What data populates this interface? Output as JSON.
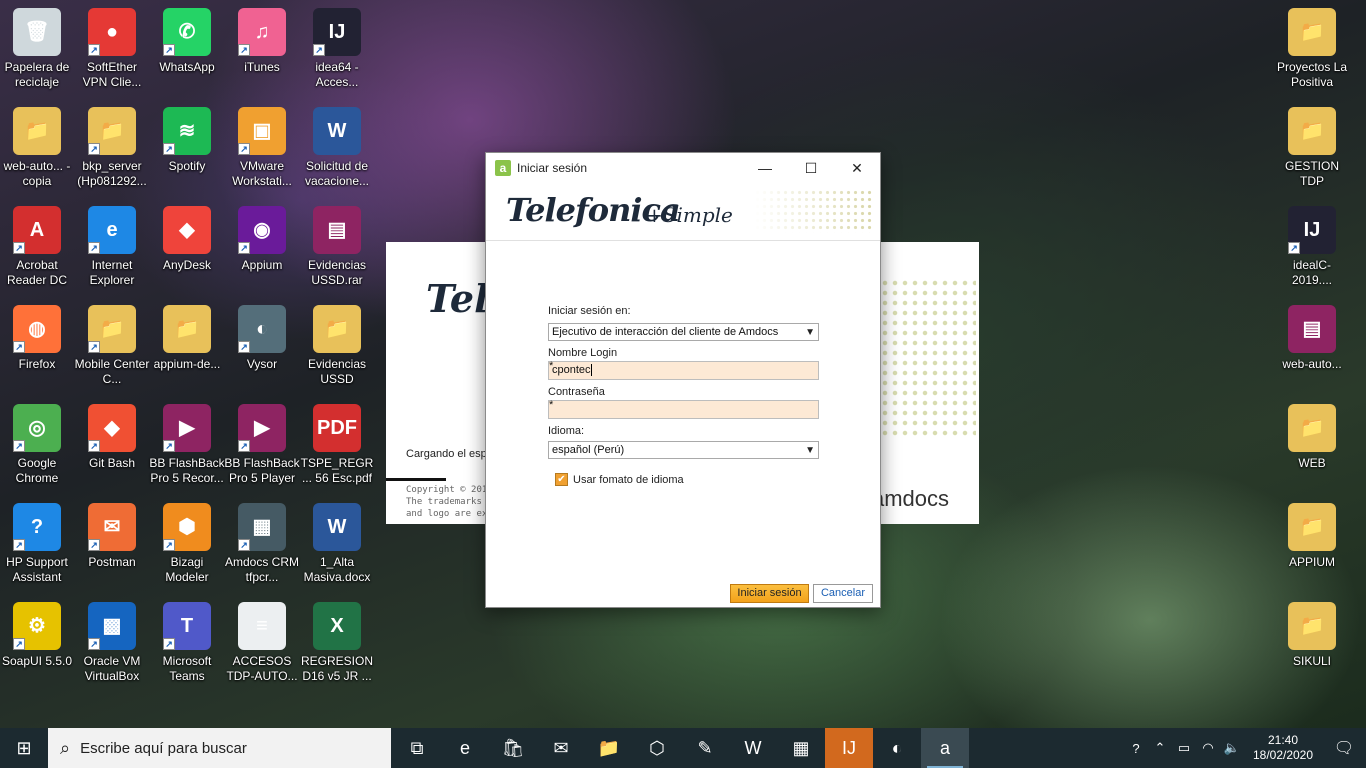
{
  "desktop_left": [
    {
      "name": "recycle-bin",
      "label": "Papelera de reciclaje",
      "color": "#cfd8dc",
      "glyph": "🗑",
      "shortcut": false
    },
    {
      "name": "softether",
      "label": "SoftEther VPN Clie...",
      "color": "#e53935",
      "glyph": "●",
      "shortcut": true
    },
    {
      "name": "whatsapp",
      "label": "WhatsApp",
      "color": "#25d366",
      "glyph": "✆",
      "shortcut": true
    },
    {
      "name": "itunes",
      "label": "iTunes",
      "color": "#f06292",
      "glyph": "♫",
      "shortcut": true
    },
    {
      "name": "idea64",
      "label": "idea64 - Acces...",
      "color": "#222233",
      "glyph": "IJ",
      "shortcut": true
    },
    {
      "name": "web-auto-copia",
      "label": "web-auto... - copia",
      "color": "#e8c15a",
      "glyph": "📁",
      "shortcut": false
    },
    {
      "name": "bkp-server",
      "label": "bkp_server (Hp081292...",
      "color": "#e8c15a",
      "glyph": "📁",
      "shortcut": true
    },
    {
      "name": "spotify",
      "label": "Spotify",
      "color": "#1db954",
      "glyph": "≋",
      "shortcut": true
    },
    {
      "name": "vmware",
      "label": "VMware Workstati...",
      "color": "#f0a030",
      "glyph": "▣",
      "shortcut": true
    },
    {
      "name": "solicitud-vacaciones",
      "label": "Solicitud de vacacione...",
      "color": "#2b579a",
      "glyph": "W",
      "shortcut": false
    },
    {
      "name": "acrobat",
      "label": "Acrobat Reader DC",
      "color": "#d32f2f",
      "glyph": "A",
      "shortcut": true
    },
    {
      "name": "internet-explorer",
      "label": "Internet Explorer",
      "color": "#1e88e5",
      "glyph": "e",
      "shortcut": true
    },
    {
      "name": "anydesk",
      "label": "AnyDesk",
      "color": "#ef443b",
      "glyph": "◆",
      "shortcut": false
    },
    {
      "name": "appium",
      "label": "Appium",
      "color": "#6a1b9a",
      "glyph": "◉",
      "shortcut": true
    },
    {
      "name": "evidencias-ussd-rar",
      "label": "Evidencias USSD.rar",
      "color": "#8e2462",
      "glyph": "▤",
      "shortcut": false
    },
    {
      "name": "firefox",
      "label": "Firefox",
      "color": "#ff7139",
      "glyph": "◍",
      "shortcut": true
    },
    {
      "name": "mobile-center",
      "label": "Mobile Center C...",
      "color": "#e8c15a",
      "glyph": "📁",
      "shortcut": true
    },
    {
      "name": "appium-de",
      "label": "appium-de...",
      "color": "#e8c15a",
      "glyph": "📁",
      "shortcut": false
    },
    {
      "name": "vysor",
      "label": "Vysor",
      "color": "#546e7a",
      "glyph": "◐",
      "shortcut": true
    },
    {
      "name": "evidencias-ussd",
      "label": "Evidencias USSD",
      "color": "#e8c15a",
      "glyph": "📁",
      "shortcut": false
    },
    {
      "name": "google-chrome",
      "label": "Google Chrome",
      "color": "#4caf50",
      "glyph": "◎",
      "shortcut": true
    },
    {
      "name": "git-bash",
      "label": "Git Bash",
      "color": "#f05033",
      "glyph": "◆",
      "shortcut": true
    },
    {
      "name": "bb-flashback-recorder",
      "label": "BB FlashBack Pro 5 Recor...",
      "color": "#8e2462",
      "glyph": "▶",
      "shortcut": true
    },
    {
      "name": "bb-flashback-player",
      "label": "BB FlashBack Pro 5 Player",
      "color": "#8e2462",
      "glyph": "▶",
      "shortcut": true
    },
    {
      "name": "tspe-regr-pdf",
      "label": "TSPE_REGR... 56 Esc.pdf",
      "color": "#d32f2f",
      "glyph": "PDF",
      "shortcut": false
    },
    {
      "name": "hp-support",
      "label": "HP Support Assistant",
      "color": "#1e88e5",
      "glyph": "?",
      "shortcut": true
    },
    {
      "name": "postman",
      "label": "Postman",
      "color": "#ef6c35",
      "glyph": "✉",
      "shortcut": true
    },
    {
      "name": "bizagi",
      "label": "Bizagi Modeler",
      "color": "#f08c1e",
      "glyph": "⬢",
      "shortcut": true
    },
    {
      "name": "amdocs-crm",
      "label": "Amdocs CRM tfpcr...",
      "color": "#455a64",
      "glyph": "▦",
      "shortcut": true
    },
    {
      "name": "alta-masiva",
      "label": "1_Alta Masiva.docx",
      "color": "#2b579a",
      "glyph": "W",
      "shortcut": false
    },
    {
      "name": "soapui",
      "label": "SoapUI 5.5.0",
      "color": "#e6c200",
      "glyph": "⚙",
      "shortcut": true
    },
    {
      "name": "virtualbox",
      "label": "Oracle VM VirtualBox",
      "color": "#1565c0",
      "glyph": "▩",
      "shortcut": true
    },
    {
      "name": "microsoft-teams",
      "label": "Microsoft Teams",
      "color": "#5059c9",
      "glyph": "T",
      "shortcut": true
    },
    {
      "name": "accesos-tdp",
      "label": "ACCESOS TDP-AUTO...",
      "color": "#eceff1",
      "glyph": "≡",
      "shortcut": false
    },
    {
      "name": "regresion-d16",
      "label": "REGRESION D16 v5 JR ...",
      "color": "#217346",
      "glyph": "X",
      "shortcut": false
    }
  ],
  "desktop_right": [
    {
      "name": "proyectos-la-positiva",
      "label": "Proyectos La Positiva",
      "color": "#e8c15a",
      "glyph": "📁",
      "shortcut": false
    },
    {
      "name": "gestion-tdp",
      "label": "GESTION TDP",
      "color": "#e8c15a",
      "glyph": "📁",
      "shortcut": false
    },
    {
      "name": "idealc-2019",
      "label": "idealC-2019....",
      "color": "#222233",
      "glyph": "IJ",
      "shortcut": true
    },
    {
      "name": "web-auto",
      "label": "web-auto...",
      "color": "#8e2462",
      "glyph": "▤",
      "shortcut": false
    },
    {
      "name": "web-folder",
      "label": "WEB",
      "color": "#e8c15a",
      "glyph": "📁",
      "shortcut": false
    },
    {
      "name": "appium-folder",
      "label": "APPIUM",
      "color": "#e8c15a",
      "glyph": "📁",
      "shortcut": false
    },
    {
      "name": "sikuli-folder",
      "label": "SIKULI",
      "color": "#e8c15a",
      "glyph": "📁",
      "shortcut": false
    }
  ],
  "splash": {
    "logo": "Telef",
    "loading": "Cargando el esp",
    "copyright": "Copyright © 2011 The trademarks a and logo are exc",
    "amdocs": "amdocs"
  },
  "dialog": {
    "title": "Iniciar sesión",
    "app_icon": "a",
    "banner_brand": "Telefonica",
    "banner_sub": "+Simple",
    "login_in_label": "Iniciar sesión en:",
    "login_in_value": "Ejecutivo de interacción del cliente de Amdocs",
    "username_label": "Nombre Login",
    "username_value": "cpontec",
    "password_label": "Contraseña",
    "password_value": "",
    "language_label": "Idioma:",
    "language_value": "español (Perú)",
    "use_format_label": "Usar fomato de idioma",
    "use_format_checked": true,
    "required_mark": "*",
    "login_button": "Iniciar sesión",
    "cancel_button": "Cancelar",
    "minimize": "—",
    "maximize": "☐",
    "close": "✕"
  },
  "taskbar": {
    "search_placeholder": "Escribe aquí para buscar",
    "apps": [
      {
        "name": "task-view",
        "glyph": "⧉",
        "active": false,
        "orange": false
      },
      {
        "name": "edge",
        "glyph": "e",
        "active": false,
        "orange": false
      },
      {
        "name": "store",
        "glyph": "🛍",
        "active": false,
        "orange": false
      },
      {
        "name": "mail",
        "glyph": "✉",
        "active": false,
        "orange": false
      },
      {
        "name": "file-explorer",
        "glyph": "📁",
        "active": false,
        "orange": false
      },
      {
        "name": "3d-viewer",
        "glyph": "⬡",
        "active": false,
        "orange": false
      },
      {
        "name": "snip",
        "glyph": "✎",
        "active": false,
        "orange": false
      },
      {
        "name": "word",
        "glyph": "W",
        "active": false,
        "orange": false
      },
      {
        "name": "calendar-app",
        "glyph": "▦",
        "active": false,
        "orange": false
      },
      {
        "name": "intellij",
        "glyph": "IJ",
        "active": false,
        "orange": true
      },
      {
        "name": "vysor",
        "glyph": "◐",
        "active": false,
        "orange": false
      },
      {
        "name": "amdocs",
        "glyph": "a",
        "active": true,
        "orange": false
      }
    ],
    "time": "21:40",
    "date": "18/02/2020"
  }
}
